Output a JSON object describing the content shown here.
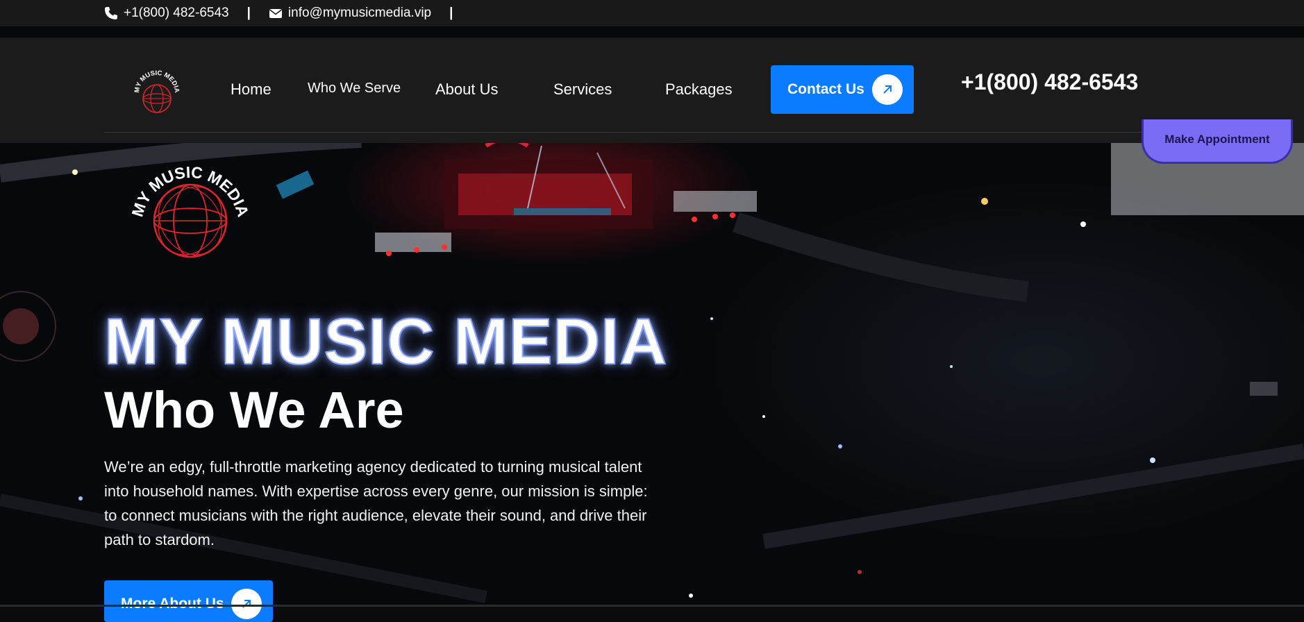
{
  "topbar": {
    "phone": "+1(800) 482-6543",
    "email": "info@mymusicmedia.vip",
    "separator": "|"
  },
  "header": {
    "logo_text": "MY MUSIC MEDIA",
    "nav": {
      "home": "Home",
      "who_we_serve": "Who We Serve",
      "about_us": "About Us",
      "services": "Services",
      "packages": "Packages"
    },
    "contact_label": "Contact Us",
    "phone": "+1(800) 482-6543",
    "appointment_label": "Make Appointment"
  },
  "hero": {
    "logo_text": "MY MUSIC MEDIA",
    "title": "MY MUSIC MEDIA",
    "subtitle": "Who We Are",
    "body": "We’re an edgy, full-throttle marketing agency dedicated to turning musical talent into household names. With expertise across every genre, our mission is simple: to connect musicians with the right audience, elevate their sound, and drive their path to stardom.",
    "button_label": "More About Us"
  },
  "colors": {
    "accent_blue": "#0b7bff",
    "appointment_purple": "#7b6cf5",
    "title_glow": "#8fa8ff",
    "logo_red": "#e0252b"
  },
  "icons": [
    "phone-icon",
    "envelope-icon",
    "arrow-up-right-icon",
    "globe-icon"
  ]
}
